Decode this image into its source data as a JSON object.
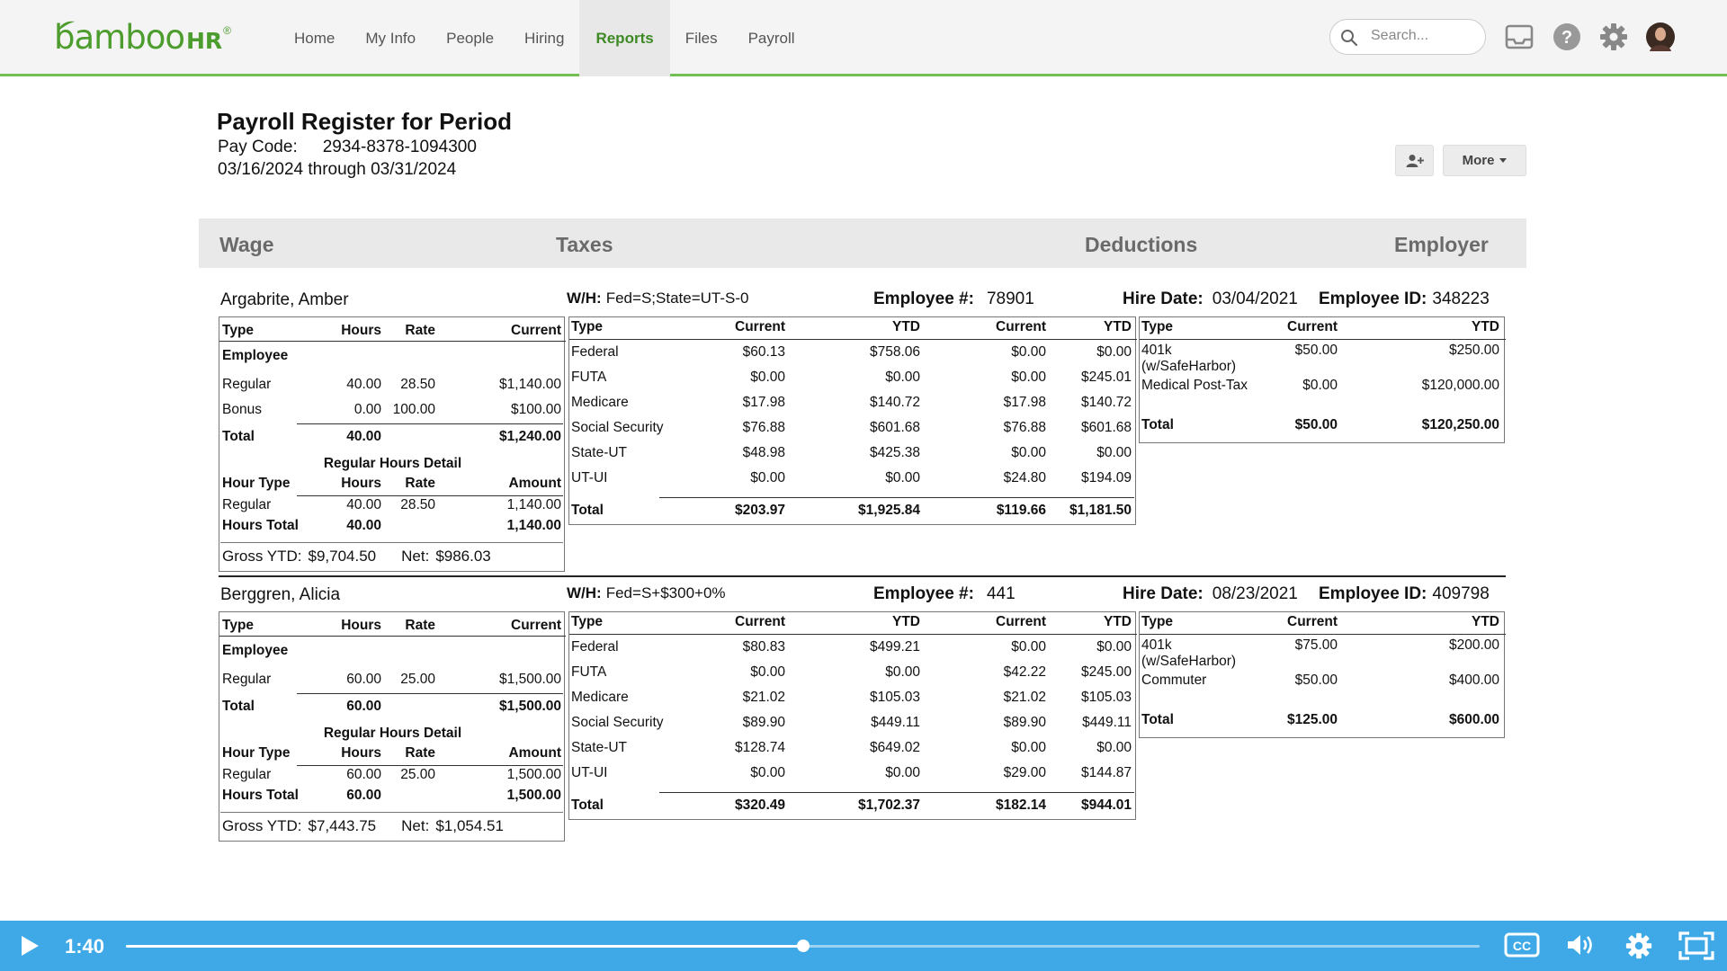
{
  "nav": {
    "logo_text": "bamboo",
    "logo_hr": "HR",
    "logo_reg": "®",
    "items": [
      {
        "label": "Home",
        "active": false
      },
      {
        "label": "My Info",
        "active": false
      },
      {
        "label": "People",
        "active": false
      },
      {
        "label": "Hiring",
        "active": false
      },
      {
        "label": "Reports",
        "active": true
      },
      {
        "label": "Files",
        "active": false
      },
      {
        "label": "Payroll",
        "active": false
      }
    ],
    "search_placeholder": "Search...",
    "icons": [
      "inbox-icon",
      "help-icon",
      "gear-icon",
      "avatar"
    ],
    "brand_color": "#4d9c2e",
    "accent_color": "#74bf54"
  },
  "report": {
    "title": "Payroll Register for Period",
    "pay_code_label": "Pay Code:",
    "pay_code": "2934-8378-1094300",
    "period": "03/16/2024 through 03/31/2024",
    "more_label": "More"
  },
  "sections": [
    "Wage",
    "Taxes",
    "Deductions",
    "Employer"
  ],
  "labels": {
    "wh": "W/H:",
    "employee_num": "Employee #:",
    "hire_date": "Hire Date:",
    "employee_id": "Employee ID:",
    "wage_headers": [
      "Type",
      "Hours",
      "Rate",
      "Current"
    ],
    "employee_group": "Employee",
    "total": "Total",
    "regular_hours_detail": "Regular Hours Detail",
    "detail_headers": [
      "Hour Type",
      "Hours",
      "Rate",
      "Amount"
    ],
    "hours_total": "Hours Total",
    "gross_ytd": "Gross YTD:",
    "net": "Net:",
    "tax_headers": [
      "Type",
      "Current",
      "YTD",
      "Current",
      "YTD"
    ],
    "ded_headers": [
      "Type",
      "Current",
      "YTD"
    ]
  },
  "employees": [
    {
      "name": "Argabrite, Amber",
      "wh": "Fed=S;State=UT-S-0",
      "employee_num": "78901",
      "hire_date": "03/04/2021",
      "employee_id": "348223",
      "wage_rows": [
        {
          "type": "Regular",
          "hours": "40.00",
          "rate": "28.50",
          "current": "$1,140.00"
        },
        {
          "type": "Bonus",
          "hours": "0.00",
          "rate": "100.00",
          "current": "$100.00"
        }
      ],
      "wage_total": {
        "hours": "40.00",
        "current": "$1,240.00"
      },
      "detail_rows": [
        {
          "type": "Regular",
          "hours": "40.00",
          "rate": "28.50",
          "amount": "1,140.00"
        }
      ],
      "detail_total": {
        "hours": "40.00",
        "amount": "1,140.00"
      },
      "gross_ytd": "$9,704.50",
      "net": "$986.03",
      "taxes": [
        {
          "type": "Federal",
          "cur1": "$60.13",
          "ytd1": "$758.06",
          "cur2": "$0.00",
          "ytd2": "$0.00"
        },
        {
          "type": "FUTA",
          "cur1": "$0.00",
          "ytd1": "$0.00",
          "cur2": "$0.00",
          "ytd2": "$245.01"
        },
        {
          "type": "Medicare",
          "cur1": "$17.98",
          "ytd1": "$140.72",
          "cur2": "$17.98",
          "ytd2": "$140.72"
        },
        {
          "type": "Social Security",
          "cur1": "$76.88",
          "ytd1": "$601.68",
          "cur2": "$76.88",
          "ytd2": "$601.68"
        },
        {
          "type": "State-UT",
          "cur1": "$48.98",
          "ytd1": "$425.38",
          "cur2": "$0.00",
          "ytd2": "$0.00"
        },
        {
          "type": "UT-UI",
          "cur1": "$0.00",
          "ytd1": "$0.00",
          "cur2": "$24.80",
          "ytd2": "$194.09"
        }
      ],
      "tax_total": {
        "cur1": "$203.97",
        "ytd1": "$1,925.84",
        "cur2": "$119.66",
        "ytd2": "$1,181.50"
      },
      "deductions": [
        {
          "type": "401k",
          "type2": "(w/SafeHarbor)",
          "current": "$50.00",
          "ytd": "$250.00"
        },
        {
          "type": "Medical Post-Tax",
          "type2": "",
          "current": "$0.00",
          "ytd": "$120,000.00"
        }
      ],
      "ded_total": {
        "current": "$50.00",
        "ytd": "$120,250.00"
      }
    },
    {
      "name": "Berggren, Alicia",
      "wh": "Fed=S+$300+0%",
      "employee_num": "441",
      "hire_date": "08/23/2021",
      "employee_id": "409798",
      "wage_rows": [
        {
          "type": "Regular",
          "hours": "60.00",
          "rate": "25.00",
          "current": "$1,500.00"
        }
      ],
      "wage_total": {
        "hours": "60.00",
        "current": "$1,500.00"
      },
      "detail_rows": [
        {
          "type": "Regular",
          "hours": "60.00",
          "rate": "25.00",
          "amount": "1,500.00"
        }
      ],
      "detail_total": {
        "hours": "60.00",
        "amount": "1,500.00"
      },
      "gross_ytd": "$7,443.75",
      "net": "$1,054.51",
      "taxes": [
        {
          "type": "Federal",
          "cur1": "$80.83",
          "ytd1": "$499.21",
          "cur2": "$0.00",
          "ytd2": "$0.00"
        },
        {
          "type": "FUTA",
          "cur1": "$0.00",
          "ytd1": "$0.00",
          "cur2": "$42.22",
          "ytd2": "$245.00"
        },
        {
          "type": "Medicare",
          "cur1": "$21.02",
          "ytd1": "$105.03",
          "cur2": "$21.02",
          "ytd2": "$105.03"
        },
        {
          "type": "Social Security",
          "cur1": "$89.90",
          "ytd1": "$449.11",
          "cur2": "$89.90",
          "ytd2": "$449.11"
        },
        {
          "type": "State-UT",
          "cur1": "$128.74",
          "ytd1": "$649.02",
          "cur2": "$0.00",
          "ytd2": "$0.00"
        },
        {
          "type": "UT-UI",
          "cur1": "$0.00",
          "ytd1": "$0.00",
          "cur2": "$29.00",
          "ytd2": "$144.87"
        }
      ],
      "tax_total": {
        "cur1": "$320.49",
        "ytd1": "$1,702.37",
        "cur2": "$182.14",
        "ytd2": "$944.01"
      },
      "deductions": [
        {
          "type": "401k",
          "type2": "(w/SafeHarbor)",
          "current": "$75.00",
          "ytd": "$200.00"
        },
        {
          "type": "Commuter",
          "type2": "",
          "current": "$50.00",
          "ytd": "$400.00"
        }
      ],
      "ded_total": {
        "current": "$125.00",
        "ytd": "$600.00"
      }
    }
  ],
  "video": {
    "time": "1:40",
    "progress": 0.5,
    "icons": [
      "play-icon",
      "cc-icon",
      "volume-icon",
      "settings-icon",
      "fullscreen-icon"
    ]
  }
}
